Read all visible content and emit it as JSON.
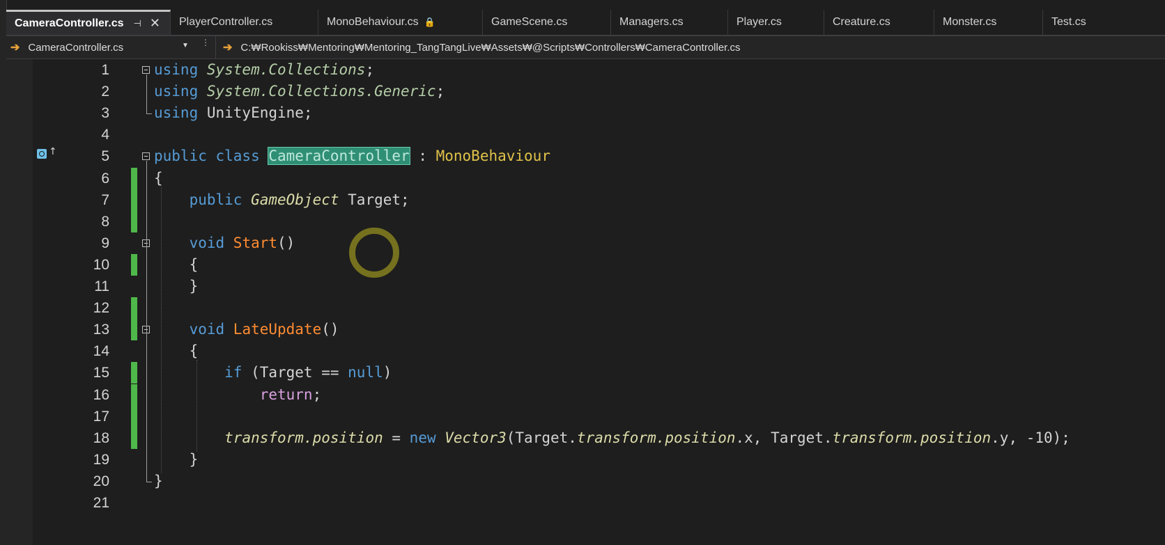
{
  "tabs": [
    {
      "label": "CameraController.cs",
      "active": true
    },
    {
      "label": "PlayerController.cs"
    },
    {
      "label": "MonoBehaviour.cs",
      "locked": true
    },
    {
      "label": "GameScene.cs"
    },
    {
      "label": "Managers.cs"
    },
    {
      "label": "Player.cs"
    },
    {
      "label": "Creature.cs"
    },
    {
      "label": "Monster.cs"
    },
    {
      "label": "Test.cs"
    }
  ],
  "tab_pin_glyph": "⊣",
  "tab_close_glyph": "✕",
  "tab_lock_glyph": "🔒",
  "nav": {
    "file_label": "CameraController.cs",
    "path": "C:₩Rookiss₩Mentoring₩Mentoring_TangTangLive₩Assets₩@Scripts₩Controllers₩CameraController.cs",
    "arrow_glyph": "➔",
    "dropdown_glyph": "▼",
    "split_glyph": "⋮"
  },
  "code_lines": [
    {
      "n": "1",
      "tokens": [
        {
          "t": "using ",
          "c": "kw"
        },
        {
          "t": "System.Collections",
          "c": "ns"
        },
        {
          "t": ";",
          "c": "pl"
        }
      ]
    },
    {
      "n": "2",
      "tokens": [
        {
          "t": "using ",
          "c": "kw"
        },
        {
          "t": "System.Collections.Generic",
          "c": "ns"
        },
        {
          "t": ";",
          "c": "pl"
        }
      ]
    },
    {
      "n": "3",
      "tokens": [
        {
          "t": "using ",
          "c": "kw"
        },
        {
          "t": "UnityEngine;",
          "c": "pl"
        }
      ]
    },
    {
      "n": "4",
      "tokens": []
    },
    {
      "n": "5",
      "tokens": [
        {
          "t": "public class ",
          "c": "kw"
        },
        {
          "t": "CameraController",
          "c": "hl"
        },
        {
          "t": " : ",
          "c": "pl"
        },
        {
          "t": "MonoBehaviour",
          "c": "tyn"
        }
      ]
    },
    {
      "n": "6",
      "tokens": [
        {
          "t": "{",
          "c": "pl"
        }
      ]
    },
    {
      "n": "7",
      "tokens": [
        {
          "t": "    public ",
          "c": "kw"
        },
        {
          "t": "GameObject",
          "c": "ty"
        },
        {
          "t": " Target;",
          "c": "pl"
        }
      ]
    },
    {
      "n": "8",
      "tokens": []
    },
    {
      "n": "9",
      "tokens": [
        {
          "t": "    void ",
          "c": "kw"
        },
        {
          "t": "Start",
          "c": "fn"
        },
        {
          "t": "()",
          "c": "pl"
        }
      ]
    },
    {
      "n": "10",
      "tokens": [
        {
          "t": "    {",
          "c": "pl"
        }
      ]
    },
    {
      "n": "11",
      "tokens": [
        {
          "t": "    }",
          "c": "pl"
        }
      ]
    },
    {
      "n": "12",
      "tokens": []
    },
    {
      "n": "13",
      "tokens": [
        {
          "t": "    void ",
          "c": "kw"
        },
        {
          "t": "LateUpdate",
          "c": "fn"
        },
        {
          "t": "()",
          "c": "pl"
        }
      ]
    },
    {
      "n": "14",
      "tokens": [
        {
          "t": "    {",
          "c": "pl"
        }
      ]
    },
    {
      "n": "15",
      "tokens": [
        {
          "t": "        if ",
          "c": "kw"
        },
        {
          "t": "(Target == ",
          "c": "pl"
        },
        {
          "t": "null",
          "c": "kw"
        },
        {
          "t": ")",
          "c": "pl"
        }
      ]
    },
    {
      "n": "16",
      "tokens": [
        {
          "t": "            return",
          "c": "ret"
        },
        {
          "t": ";",
          "c": "pl"
        }
      ]
    },
    {
      "n": "17",
      "tokens": []
    },
    {
      "n": "18",
      "tokens": [
        {
          "t": "        ",
          "c": "pl"
        },
        {
          "t": "transform.position",
          "c": "prop"
        },
        {
          "t": " = ",
          "c": "pl"
        },
        {
          "t": "new ",
          "c": "kw"
        },
        {
          "t": "Vector3",
          "c": "ty"
        },
        {
          "t": "(Target.",
          "c": "pl"
        },
        {
          "t": "transform.position",
          "c": "prop"
        },
        {
          "t": ".x, Target.",
          "c": "pl"
        },
        {
          "t": "transform.position",
          "c": "prop"
        },
        {
          "t": ".y, -10);",
          "c": "pl"
        }
      ]
    },
    {
      "n": "19",
      "tokens": [
        {
          "t": "    }",
          "c": "pl"
        }
      ]
    },
    {
      "n": "20",
      "tokens": [
        {
          "t": "}",
          "c": "pl"
        }
      ]
    },
    {
      "n": "21",
      "tokens": []
    }
  ],
  "changed_lines": [
    "6",
    "7",
    "8",
    "10",
    "12",
    "13",
    "15",
    "16",
    "17",
    "18"
  ],
  "fold_lines": [
    "1",
    "5",
    "9",
    "13"
  ]
}
